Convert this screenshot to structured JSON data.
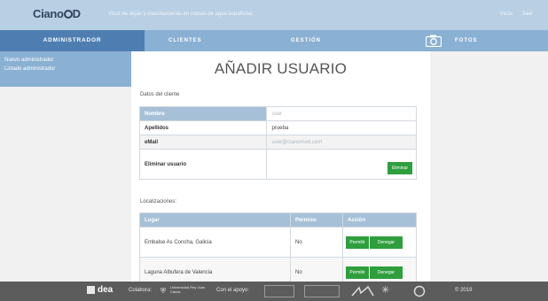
{
  "header": {
    "logo": "Ciano",
    "logo_suffix": "D",
    "subtitle": "Visor de algas y cianobacterias en masas de agua españolas",
    "links": [
      "Inicio",
      "Salir"
    ]
  },
  "nav": {
    "admin_label": "ADMINISTRADOR",
    "items": [
      "CLIENTES",
      "GESTIÓN",
      "FOTOS"
    ]
  },
  "sidebar": {
    "items": [
      "Nuevo administrador",
      "Listado administrador"
    ]
  },
  "main": {
    "title": "AÑADIR USUARIO",
    "client_section": "Datos del cliente",
    "client_table": {
      "headers": [
        "Nombre",
        "user"
      ],
      "rows": [
        {
          "label": "Apellidos",
          "value": "prueba"
        },
        {
          "label": "eMail",
          "value": "user@cianomod.com"
        }
      ],
      "delete_label": "Eliminar usuario",
      "delete_button": "Eliminar"
    },
    "loc_section": "Localizaciones:",
    "loc_table": {
      "headers": [
        "Lugar",
        "Permiso",
        "Acción"
      ],
      "rows": [
        {
          "place": "Embalse As Concha, Galicia",
          "permit": "No",
          "allow": "Permitir",
          "deny": "Denegar"
        },
        {
          "place": "Laguna Albufera de Valencia",
          "permit": "No",
          "allow": "Permitir",
          "deny": "Denegar"
        }
      ]
    }
  },
  "footer": {
    "brand": "dea",
    "collabora": "Colabora:",
    "university": "Universidad Rey Juan Carlos",
    "support": "Con el apoyo:",
    "year": "© 2019"
  },
  "colors": {
    "topbar": "#b9cfe3",
    "navbar": "#8ab0d3",
    "nav_active": "#4e7eb1",
    "table_header": "#a6c0d8",
    "button_green": "#2f9e3d",
    "footer": "#5c5c5c"
  }
}
